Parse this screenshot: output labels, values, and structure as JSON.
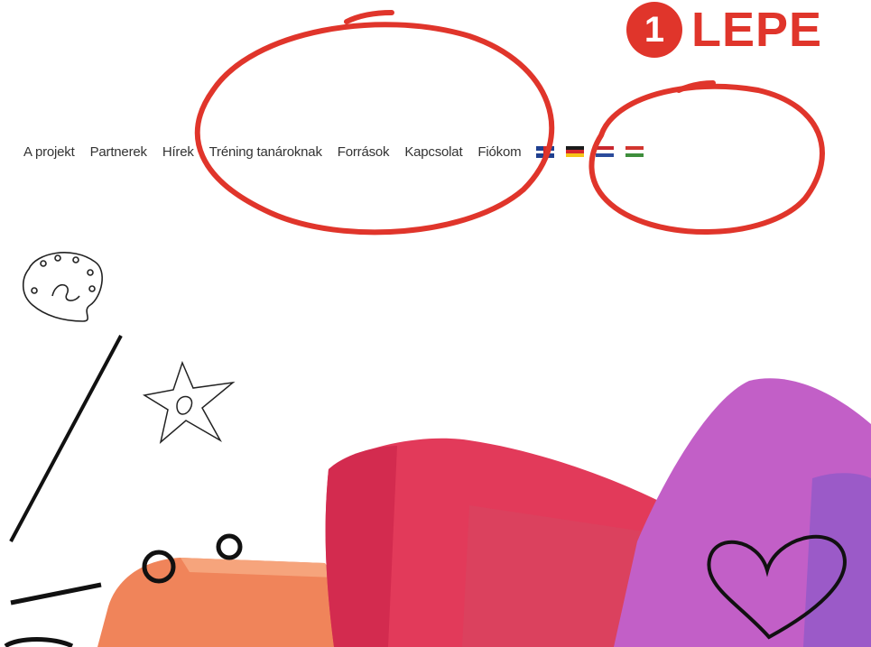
{
  "step_badge": {
    "number": "1",
    "label": "LEPE"
  },
  "nav": {
    "items": [
      {
        "label": "A projekt"
      },
      {
        "label": "Partnerek"
      },
      {
        "label": "Hírek"
      },
      {
        "label": "Tréning tanároknak"
      },
      {
        "label": "Források"
      },
      {
        "label": "Kapcsolat"
      },
      {
        "label": "Fiókom"
      }
    ],
    "flags": [
      {
        "name": "uk-flag-icon"
      },
      {
        "name": "germany-flag-icon",
        "colors": [
          "#1a1a1a",
          "#d7262b",
          "#f5c518"
        ]
      },
      {
        "name": "netherlands-flag-icon",
        "colors": [
          "#c8262e",
          "#ffffff",
          "#2b4b9b"
        ]
      },
      {
        "name": "hungary-flag-icon",
        "colors": [
          "#d2352f",
          "#ffffff",
          "#3e8e3c"
        ]
      }
    ]
  },
  "colors": {
    "annotation_red": "#e0352b",
    "nav_text": "#333333",
    "book_red": "#e23a5a",
    "book_orange": "#f0845a",
    "book_purple": "#c25fc7"
  }
}
